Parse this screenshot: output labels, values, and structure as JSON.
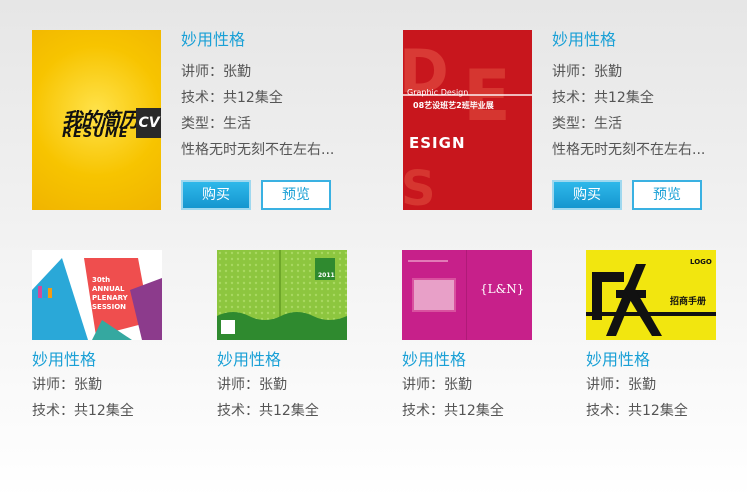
{
  "featured": [
    {
      "title": "妙用性格",
      "teacher": "讲师：张勤",
      "tech": "技术：共12集全",
      "type": "类型：生活",
      "desc": "性格无时无刻不在左右...",
      "buy_label": "购买",
      "preview_label": "预览",
      "cover": {
        "line1": "我的简历",
        "line2": "RESUME",
        "badge": "CV",
        "bg": "#f7c800"
      }
    },
    {
      "title": "妙用性格",
      "teacher": "讲师：张勤",
      "tech": "技术：共12集全",
      "type": "类型：生活",
      "desc": "性格无时无刻不在左右...",
      "buy_label": "购买",
      "preview_label": "预览",
      "cover": {
        "line1": "Graphic Design",
        "line2": "08艺设班艺2班毕业展",
        "line3": "ESIGN",
        "bg": "#c8161d"
      }
    }
  ],
  "cards": [
    {
      "title": "妙用性格",
      "teacher": "讲师：张勤",
      "tech": "技术：共12集全",
      "thumb": {
        "text": "30th ANNUAL PLENARY SESSION"
      }
    },
    {
      "title": "妙用性格",
      "teacher": "讲师：张勤",
      "tech": "技术：共12集全",
      "thumb": {
        "text": "2011"
      }
    },
    {
      "title": "妙用性格",
      "teacher": "讲师：张勤",
      "tech": "技术：共12集全",
      "thumb": {
        "text": "{L&N}"
      }
    },
    {
      "title": "妙用性格",
      "teacher": "讲师：张勤",
      "tech": "技术：共12集全",
      "thumb": {
        "text": "LOGO",
        "sub": "招商手册"
      }
    }
  ],
  "colors": {
    "accent": "#1aa0d6",
    "text": "#555555",
    "button_fill": "#1596cf"
  }
}
